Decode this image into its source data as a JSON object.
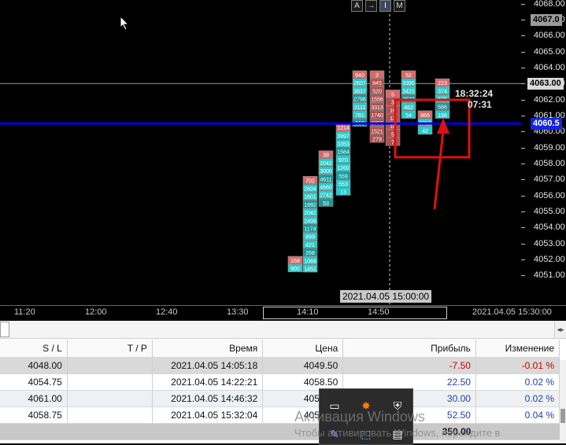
{
  "toolbar": {
    "buttons": [
      "A",
      "→",
      "I",
      "M"
    ]
  },
  "price_axis": {
    "labels": [
      "4068.00",
      "4067.00",
      "4066.00",
      "4065.00",
      "4064.00",
      "4063.00",
      "4062.00",
      "4061.00",
      "4060.00",
      "4059.00",
      "4058.00",
      "4057.00",
      "4056.00",
      "4055.00",
      "4054.00",
      "4053.00",
      "4052.00",
      "4051.00"
    ],
    "current_price_tag": "4067.0",
    "crosshair_price_tag": "4063.00",
    "order_price_tag": "4060.5"
  },
  "timer": {
    "clock": "18:32:24",
    "countdown": "07:31"
  },
  "time_axis": {
    "labels": [
      "11:20",
      "12:00",
      "12:40",
      "13:30",
      "14:10",
      "14:50"
    ],
    "right_label": "2021.04.05 15:30:00",
    "hover_label": "2021.04.05 15:00:00"
  },
  "bars": [
    {
      "col": 0,
      "top_price": 4052.2,
      "cells": [
        "158",
        "900"
      ],
      "color": "#2bc9c9"
    },
    {
      "col": 1,
      "top_price": 4057.2,
      "cells": [
        "702",
        "2834",
        "1601",
        "1992",
        "2042",
        "2499",
        "1174",
        "899",
        "421",
        "268",
        "1069",
        "1451"
      ],
      "color": "#2bc9c9"
    },
    {
      "col": 2,
      "top_price": 4058.8,
      "cells": [
        "38",
        "2042",
        "3000",
        "4611",
        "4660",
        "2742",
        "53"
      ],
      "color": "#2bc9c9"
    },
    {
      "col": 3,
      "top_price": 4060.5,
      "cells": [
        "1214",
        "3997",
        "3353",
        "1584",
        "970",
        "1260",
        "559",
        "553",
        "13"
      ],
      "color": "#2bc9c9"
    },
    {
      "col": 4,
      "top_price": 4063.8,
      "cells": [
        "940",
        "2607",
        "3837",
        "2798",
        "2111",
        "781",
        "318"
      ],
      "color": "#2bc9c9"
    },
    {
      "col": 5,
      "top_price": 4063.8,
      "cells": [
        "2",
        "845",
        "520",
        "1556",
        "3313",
        "1740",
        "2793",
        "1521",
        "279"
      ],
      "color": "#d86a6a"
    },
    {
      "col": 6,
      "top_price": 4062.6,
      "cells": [
        "5",
        "3",
        "16",
        "13",
        "18",
        "5",
        "7"
      ],
      "color": "#d86a6a"
    },
    {
      "col": 7,
      "top_price": 4063.8,
      "cells": [
        "52",
        "3390",
        "3421",
        "2583",
        "462",
        "54"
      ],
      "color": "#2bc9c9"
    },
    {
      "col": 8,
      "top_price": 4061.3,
      "cells": [
        "866",
        "3712",
        "42"
      ],
      "color": "#2bc9c9"
    },
    {
      "col": 9,
      "top_price": 4063.3,
      "cells": [
        "223",
        "374",
        "675",
        "586",
        "196"
      ],
      "color": "#2bc9c9"
    }
  ],
  "orders_table": {
    "columns": [
      "S / L",
      "T / P",
      "Время",
      "Цена",
      "Прибыль",
      "Изменение"
    ],
    "rows": [
      {
        "sl": "4048.00",
        "tp": "",
        "time": "2021.04.05 14:05:18",
        "price": "4049.50",
        "profit": "-7.50",
        "change": "-0.01 %"
      },
      {
        "sl": "4054.75",
        "tp": "",
        "time": "2021.04.05 14:22:21",
        "price": "4058.50",
        "profit": "22.50",
        "change": "0.02 %"
      },
      {
        "sl": "4061.00",
        "tp": "",
        "time": "2021.04.05 14:46:32",
        "price": "4058.50",
        "profit": "30.00",
        "change": "0.02 %"
      },
      {
        "sl": "4058.75",
        "tp": "",
        "time": "2021.04.05 15:32:04",
        "price": "4058.50",
        "profit": "52.50",
        "change": "0.04 %"
      }
    ],
    "total_profit": "350.00"
  },
  "watermark": {
    "title": "Активация Windows",
    "subtitle": "Чтобы активировать Windows, перейдите в"
  },
  "colors": {
    "order_line": "#0000e0",
    "annotation": "#e01010",
    "cyan_bar": "#2bc9c9",
    "red_bar": "#d86a6a"
  }
}
